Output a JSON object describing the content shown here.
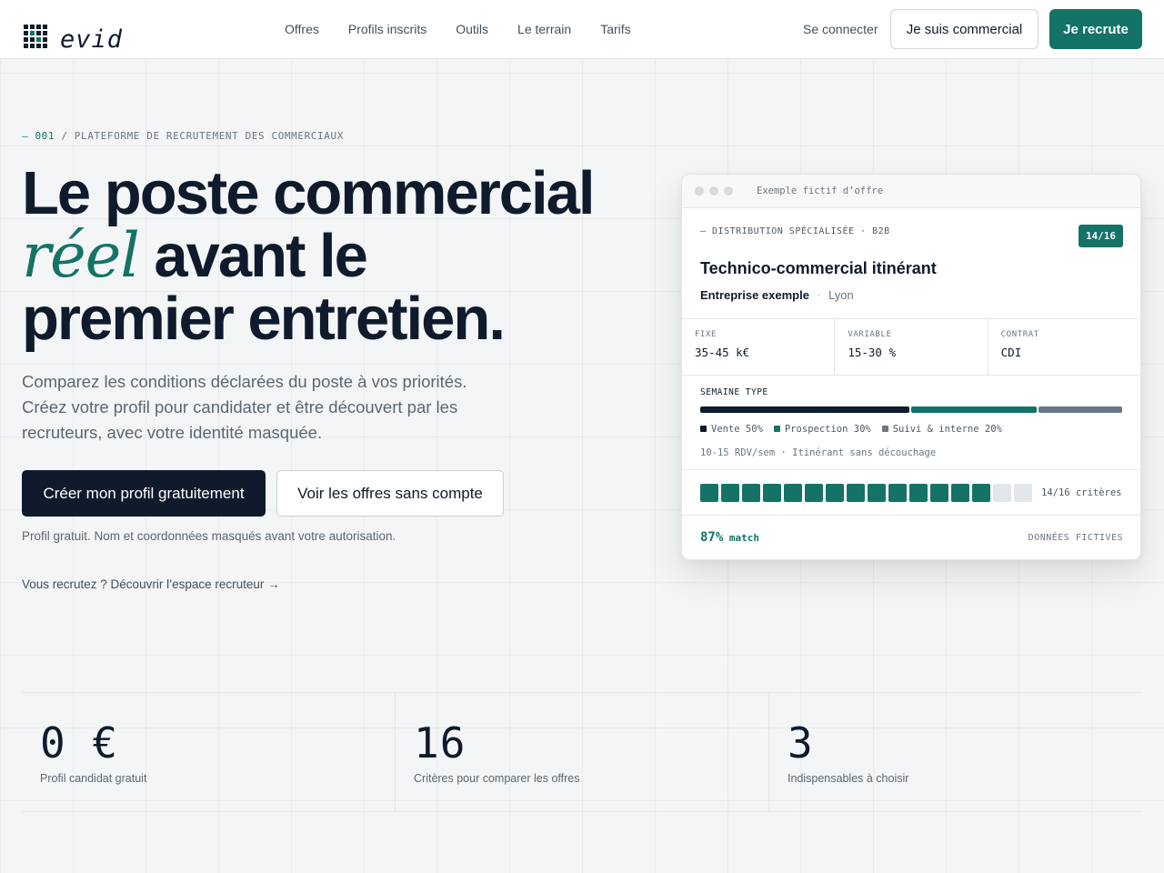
{
  "nav": {
    "brand": "evid",
    "menu": [
      "Offres",
      "Profils inscrits",
      "Outils",
      "Le terrain",
      "Tarifs"
    ],
    "login": "Se connecter",
    "commercial_button": "Je suis commercial",
    "recruiter_button": "Je recrute"
  },
  "hero": {
    "eyebrow_num": "— 001",
    "eyebrow_text": " / PLATEFORME DE RECRUTEMENT DES COMMERCIAUX",
    "title_line1": "Le poste commercial",
    "title_accent": "réel",
    "title_line2_rest": " avant le",
    "title_line3": "premier entretien.",
    "subtitle": "Comparez les conditions déclarées du poste à vos priorités. Créez votre profil pour candidater et être découvert par les recruteurs, avec votre identité masquée.",
    "cta_primary": "Créer mon profil gratuitement",
    "cta_secondary": "Voir les offres sans compte",
    "note": "Profil gratuit. Nom et coordonnées masqués avant votre autorisation.",
    "recruiter_link": "Vous recrutez ? Découvrir l’espace recruteur →"
  },
  "card": {
    "window_label": "Exemple fictif d’offre",
    "sector": "— DISTRIBUTION SPÉCIALISÉE · B2B",
    "badge": "14/16",
    "title": "Technico-commercial itinérant",
    "company": "Entreprise exemple",
    "separator": "·",
    "city": "Lyon",
    "facts": [
      {
        "label": "FIXE",
        "value": "35-45 k€"
      },
      {
        "label": "VARIABLE",
        "value": "15-30 %"
      },
      {
        "label": "CONTRAT",
        "value": "CDI"
      }
    ],
    "week": {
      "label": "SEMAINE TYPE",
      "segments": [
        {
          "label": "Vente 50%",
          "percent": 50,
          "color": "#0f1b2d"
        },
        {
          "label": "Prospection 30%",
          "percent": 30,
          "color": "#137366"
        },
        {
          "label": "Suivi & interne 20%",
          "percent": 20,
          "color": "#6b7787"
        }
      ],
      "footer": "10-15 RDV/sem · Itinérant sans découchage"
    },
    "criteria": {
      "met": 14,
      "total": 16,
      "label": "14/16 critères",
      "on_color": "#137366",
      "off_color": "#e2e6ea"
    },
    "match_value": "87%",
    "match_word": " match",
    "fictive": "DONNÉES FICTIVES"
  },
  "stats": [
    {
      "value": "0 €",
      "label": "Profil candidat gratuit"
    },
    {
      "value": "16",
      "label": "Critères pour comparer les offres"
    },
    {
      "value": "3",
      "label": "Indispensables à choisir"
    }
  ],
  "colors": {
    "accent": "#137366",
    "ink": "#0f1b2d"
  }
}
